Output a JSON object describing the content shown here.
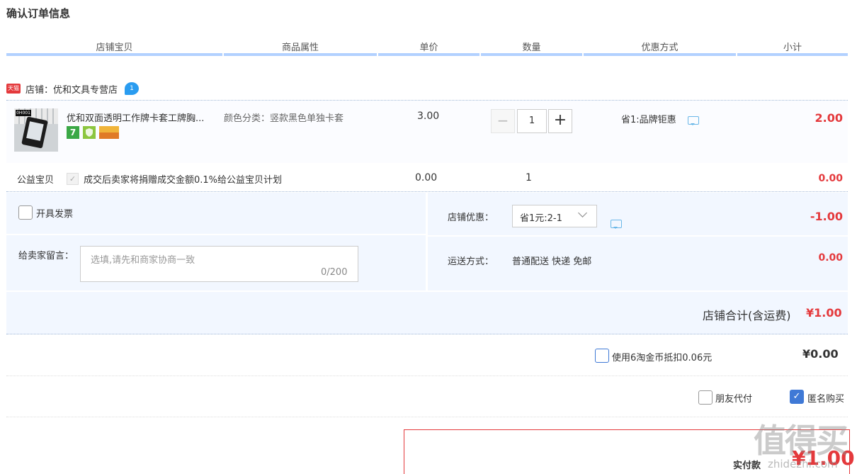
{
  "page": {
    "title": "确认订单信息"
  },
  "columns": [
    "店铺宝贝",
    "商品属性",
    "单价",
    "数量",
    "优惠方式",
    "小计"
  ],
  "shop": {
    "badge": "天猫",
    "label": "店铺：优和文具专营店",
    "ww_badge": "1"
  },
  "item": {
    "thumb_tag": "0H001",
    "title": "优和双面透明工作牌卡套工牌胸...",
    "badges": [
      "7",
      "",
      ""
    ],
    "sku": "颜色分类：竖款黑色单独卡套",
    "price": "3.00",
    "qty_minus": "−",
    "quantity": "1",
    "qty_plus": "+",
    "promo": "省1:品牌钜惠",
    "subtotal": "2.00"
  },
  "charity": {
    "label": "公益宝贝",
    "check": "✓",
    "text": "成交后卖家将捐赠成交金额0.1%给公益宝贝计划",
    "price": "0.00",
    "quantity": "1",
    "subtotal": "0.00"
  },
  "invoice": {
    "label": "开具发票",
    "checked": false
  },
  "message": {
    "label": "给卖家留言：",
    "placeholder": "选填,请先和商家协商一致",
    "count": "0/200"
  },
  "shop_discount": {
    "label": "店铺优惠：",
    "selected": "省1元:2-1",
    "amount": "-1.00"
  },
  "shipping": {
    "label": "运送方式：",
    "value": "普通配送 快递 免邮",
    "amount": "0.00"
  },
  "shop_total": {
    "label": "店铺合计(含运费)",
    "value": "¥1.00"
  },
  "coins": {
    "label": "使用6淘金币抵扣0.06元",
    "checked": false,
    "value": "¥0.00"
  },
  "options": {
    "friend_pay": "朋友代付",
    "friend_pay_checked": false,
    "anonymous": "匿名购买",
    "anonymous_checked": true,
    "check": "✓"
  },
  "pay": {
    "label": "实付款",
    "value": "¥1.00"
  },
  "watermark": {
    "text": "值得买",
    "url": "zhidezhi.com"
  },
  "colors": {
    "accent_red": "#e4393c",
    "header_bar": "#b2d1ff",
    "panel_bg": "#f2f7ff",
    "checkbox_blue": "#3f79d6"
  }
}
